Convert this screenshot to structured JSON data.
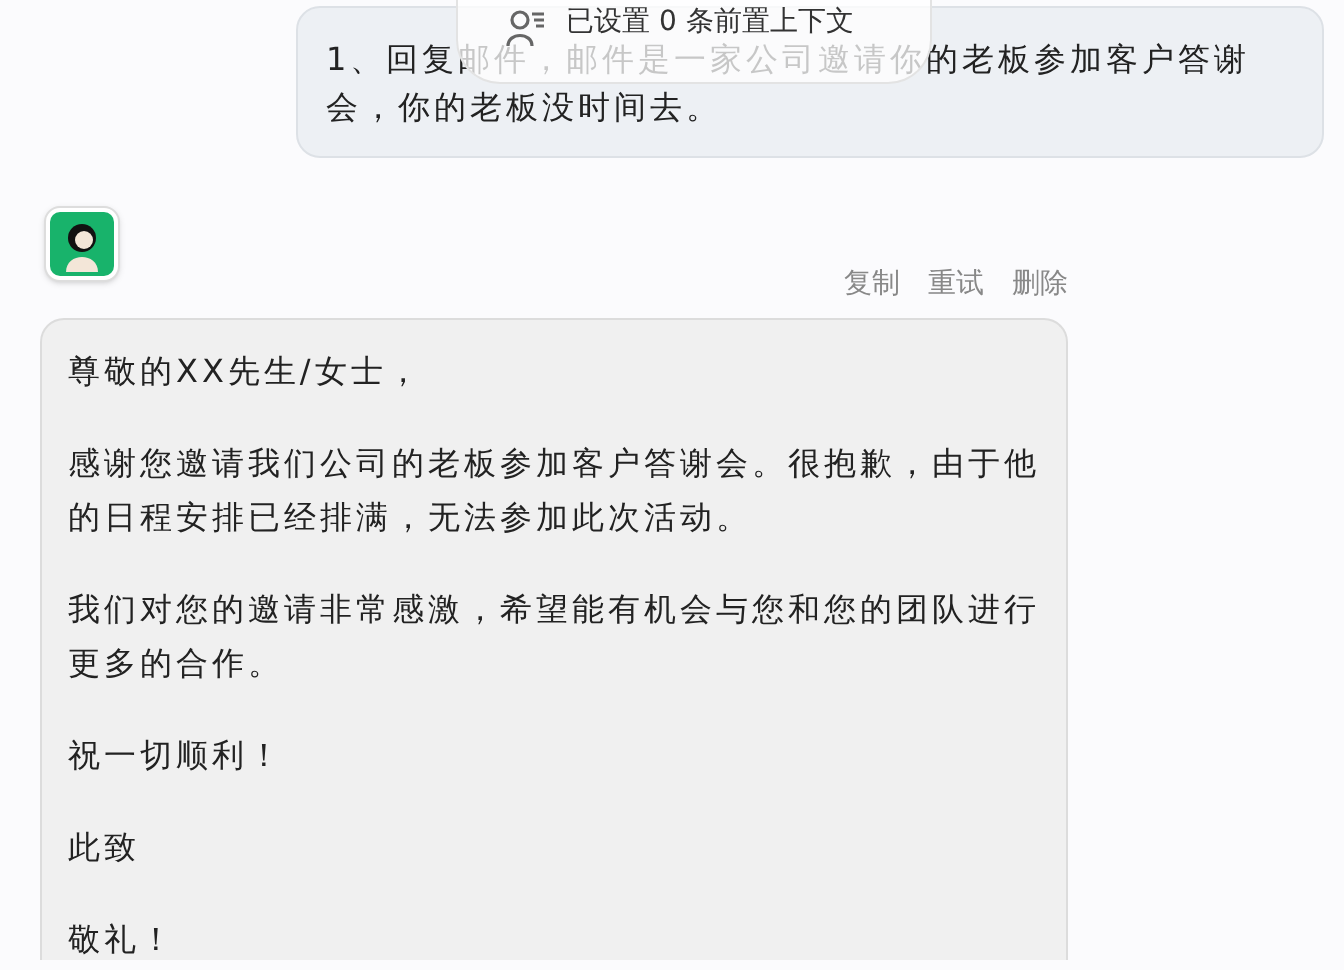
{
  "user_message": {
    "text": "1、回复邮件，邮件是一家公司邀请你的老板参加客户答谢会，你的老板没时间去。"
  },
  "context_pill": {
    "text": "已设置 0 条前置上下文"
  },
  "assistant_actions": [
    "复制",
    "重试",
    "删除"
  ],
  "assistant_message": {
    "paragraphs": [
      "尊敬的XX先生/女士，",
      "感谢您邀请我们公司的老板参加客户答谢会。很抱歉，由于他的日程安排已经排满，无法参加此次活动。",
      "我们对您的邀请非常感激，希望能有机会与您和您的团队进行更多的合作。",
      "祝一切顺利！",
      "此致",
      "敬礼！"
    ]
  }
}
